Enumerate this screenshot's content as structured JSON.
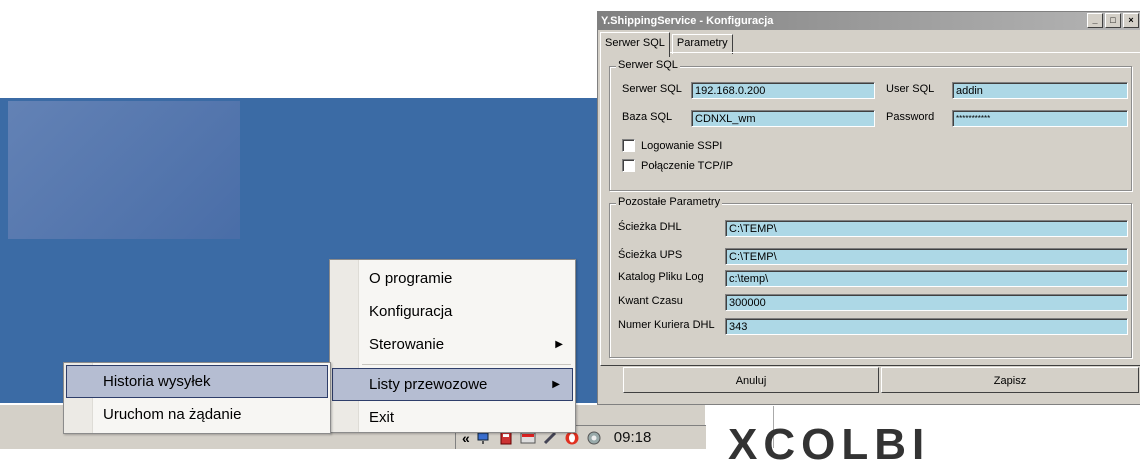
{
  "window": {
    "title": "Y.ShippingService - Konfiguracja",
    "tabs": [
      {
        "label": "Serwer SQL"
      },
      {
        "label": "Parametry"
      }
    ],
    "sql_group": {
      "title": "Serwer SQL",
      "server_label": "Serwer SQL",
      "server_value": "192.168.0.200",
      "user_label": "User SQL",
      "user_value": "addin",
      "db_label": "Baza SQL",
      "db_value": "CDNXL_wm",
      "password_label": "Password",
      "password_value": "***********",
      "sspi_label": "Logowanie SSPI",
      "tcp_label": "Połączenie TCP/IP"
    },
    "params_group": {
      "title": "Pozostałe Parametry",
      "dhl_label": "Ścieżka DHL",
      "dhl_value": "C:\\TEMP\\",
      "ups_label": "Ścieżka UPS",
      "ups_value": "C:\\TEMP\\",
      "log_label": "Katalog Pliku Log",
      "log_value": "c:\\temp\\",
      "quantum_label": "Kwant Czasu",
      "quantum_value": "300000",
      "courier_label": "Numer Kuriera DHL",
      "courier_value": "343"
    },
    "cancel_label": "Anuluj",
    "save_label": "Zapisz"
  },
  "context_menu": {
    "items": [
      {
        "label": "O programie"
      },
      {
        "label": "Konfiguracja"
      },
      {
        "label": "Sterowanie"
      },
      {
        "label": "Listy przewozowe"
      },
      {
        "label": "Exit"
      }
    ]
  },
  "submenu": {
    "items": [
      {
        "label": "Historia wysyłek"
      },
      {
        "label": "Uruchom na żądanie"
      }
    ]
  },
  "tray": {
    "expand": "«",
    "clock": "09:18"
  },
  "brand_text": "XCOLBI",
  "icons": [
    "network-icon",
    "security-icon",
    "mail-icon",
    "tool-icon",
    "opera-icon",
    "sync-icon"
  ]
}
